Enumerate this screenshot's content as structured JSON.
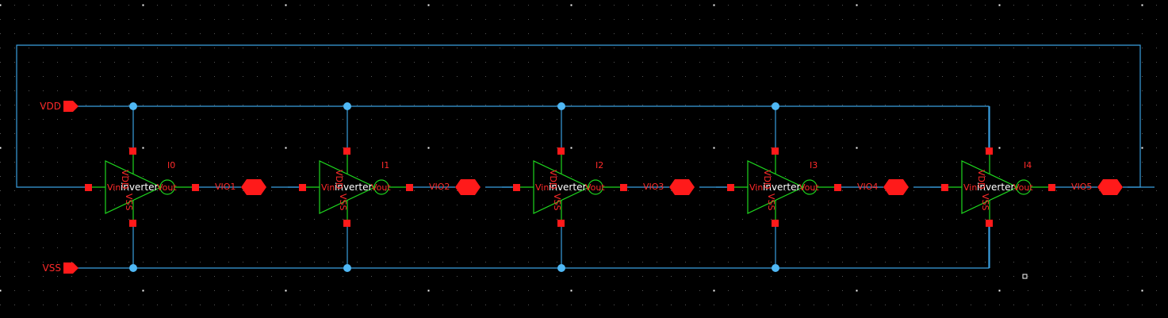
{
  "schematic": {
    "ports": {
      "vdd": "VDD",
      "vss": "VSS"
    },
    "cells": [
      {
        "instance": "I0",
        "cell": "inverter",
        "in_pin": "Vin",
        "out_pin": "Vout",
        "vdd_pin": "VDD",
        "vss_pin": "VSS",
        "out_net": "VIO1"
      },
      {
        "instance": "I1",
        "cell": "inverter",
        "in_pin": "Vin",
        "out_pin": "Vout",
        "vdd_pin": "VDD",
        "vss_pin": "VSS",
        "out_net": "VIO2"
      },
      {
        "instance": "I2",
        "cell": "inverter",
        "in_pin": "Vin",
        "out_pin": "Vout",
        "vdd_pin": "VDD",
        "vss_pin": "VSS",
        "out_net": "VIO3"
      },
      {
        "instance": "I3",
        "cell": "inverter",
        "in_pin": "Vin",
        "out_pin": "Vout",
        "vdd_pin": "VDD",
        "vss_pin": "VSS",
        "out_net": "VIO4"
      },
      {
        "instance": "I4",
        "cell": "inverter",
        "in_pin": "Vin",
        "out_pin": "Vout",
        "vdd_pin": "VDD",
        "vss_pin": "VSS",
        "out_net": "VIO5"
      }
    ],
    "colors": {
      "background": "#000000",
      "wire": "#3a9fe0",
      "junction": "#4fb8f5",
      "pin": "#ff1a1a",
      "label": "#ff2a2a",
      "symbol": "#1ed61e",
      "grid": "#9a9a9a"
    }
  }
}
